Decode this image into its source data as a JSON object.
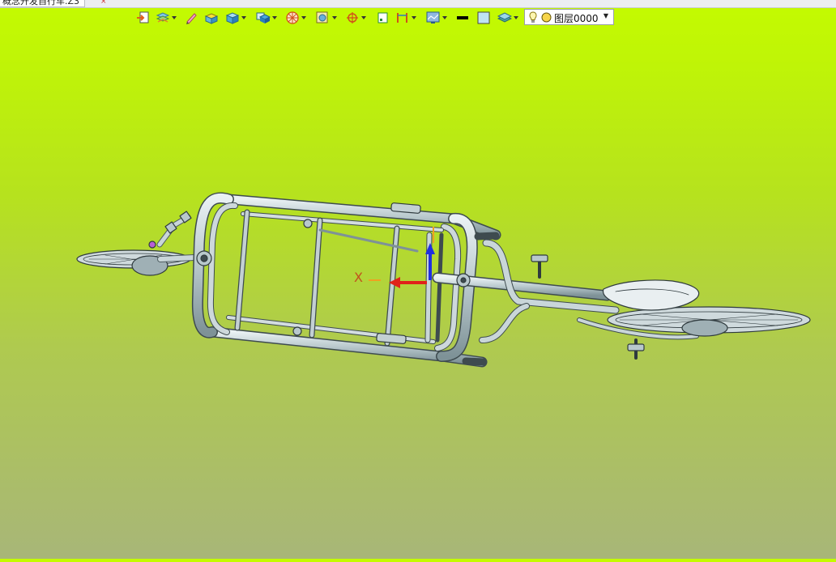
{
  "document": {
    "tab_label": "概念开发自行车.Z3",
    "close_glyph": "×"
  },
  "toolbar": {
    "items": [
      {
        "icon": "import-icon"
      },
      {
        "icon": "layers-tool-icon"
      },
      {
        "icon": "pencil-icon"
      },
      {
        "icon": "extrude-icon"
      },
      {
        "icon": "solid-box-icon"
      },
      {
        "icon": "shaded-view-icon"
      },
      {
        "icon": "render-sphere-icon"
      },
      {
        "icon": "display-filter-icon"
      },
      {
        "icon": "snap-point-icon"
      },
      {
        "icon": "small-view-icon"
      },
      {
        "icon": "measure-icon"
      },
      {
        "icon": "screen-capture-icon"
      },
      {
        "icon": "line-color-swatch"
      },
      {
        "icon": "fill-color-swatch"
      },
      {
        "icon": "layer-stack-icon"
      }
    ],
    "line_color": "#000000",
    "fill_color": "#bfe4f2"
  },
  "layer": {
    "current": "图层0000",
    "bulb_color": "#f7d54a"
  },
  "viewport": {
    "axis_label": "X",
    "background_top": "#c4fb00",
    "background_bottom": "#a8b678",
    "model_color": "#b8c8cc"
  }
}
